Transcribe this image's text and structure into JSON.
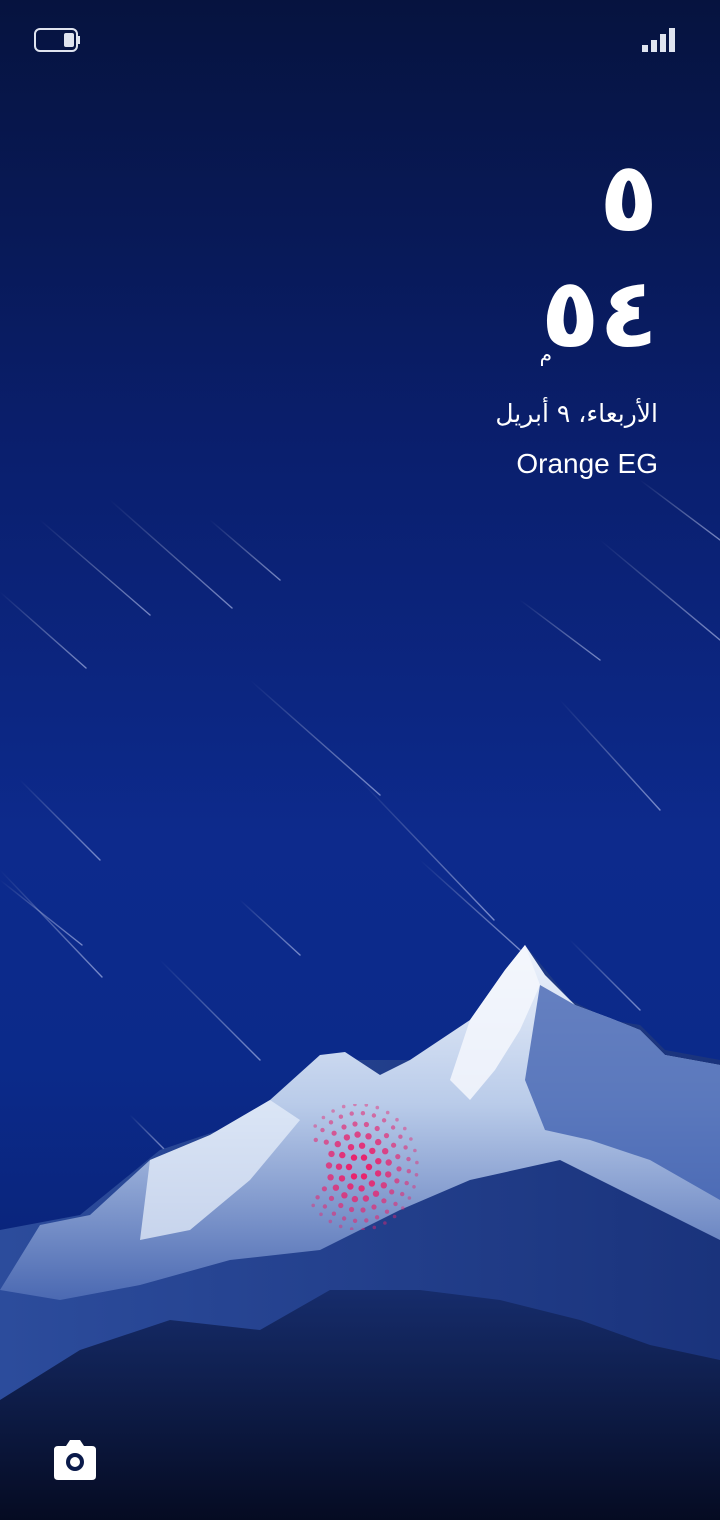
{
  "status_bar": {
    "battery_icon": "battery-icon",
    "signal_icon": "signal-icon",
    "battery_level": 0.3,
    "signal_bars": 4
  },
  "lock_screen": {
    "hour": "٥",
    "minute": "٥٤",
    "period": "م",
    "date": "الأربعاء، ٩ أبريل",
    "carrier": "Orange EG"
  },
  "fingerprint": {
    "icon": "fingerprint-icon",
    "color": "#e8246e"
  },
  "shortcuts": {
    "camera_icon": "camera-icon"
  },
  "colors": {
    "sky_top": "#06133f",
    "sky_mid": "#0d2a8c",
    "mountain_snow": "#dbe6f7",
    "mountain_shadow": "#1b3a86",
    "text": "#ffffff"
  }
}
